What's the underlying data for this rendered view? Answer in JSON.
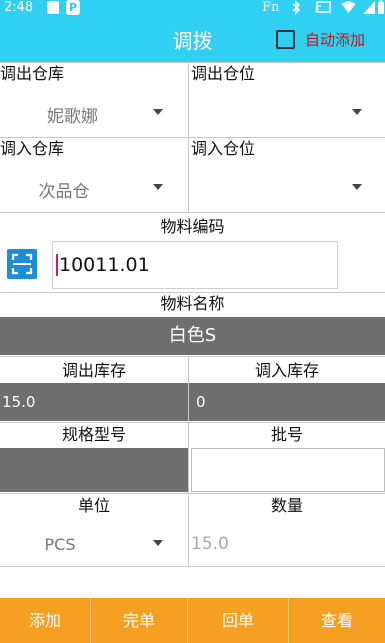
{
  "status_bar": {
    "time": "2:48",
    "app_badge": "P",
    "fn_label": "Fn"
  },
  "app_bar": {
    "title": "调拨",
    "auto_add_label": "自动添加",
    "auto_add_checked": false
  },
  "form": {
    "out_warehouse_label": "调出仓库",
    "out_location_label": "调出仓位",
    "out_warehouse_value": "妮歌娜",
    "out_location_value": "",
    "in_warehouse_label": "调入仓库",
    "in_location_label": "调入仓位",
    "in_warehouse_value": "次品仓",
    "in_location_value": "",
    "material_code_label": "物料编码",
    "material_code_value": "10011.01",
    "material_name_label": "物料名称",
    "material_name_value": "白色S",
    "out_stock_label": "调出库存",
    "in_stock_label": "调入库存",
    "out_stock_value": "15.0",
    "in_stock_value": "0",
    "spec_label": "规格型号",
    "batch_label": "批号",
    "spec_value": "",
    "batch_value": "",
    "unit_label": "单位",
    "qty_label": "数量",
    "unit_value": "PCS",
    "qty_placeholder": "15.0"
  },
  "buttons": {
    "add": "添加",
    "complete": "完单",
    "return": "回单",
    "view": "查看"
  },
  "colors": {
    "accent": "#2fd0f2",
    "bottom_bar": "#f5a021",
    "readonly_fill": "#6e6e6e",
    "auto_add_label": "#c21818",
    "scan_button": "#1e8cd6"
  }
}
